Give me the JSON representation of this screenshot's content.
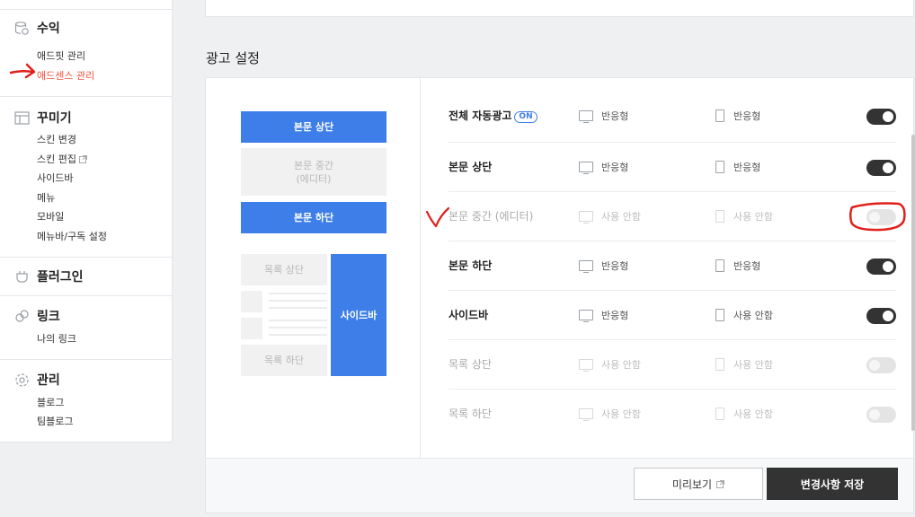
{
  "sidebar": {
    "revenue": {
      "title": "수익",
      "icon": "database-coin-icon",
      "items": [
        "애드핏 관리",
        "애드센스 관리"
      ],
      "active_item": "애드센스 관리"
    },
    "decorate": {
      "title": "꾸미기",
      "icon": "layout-icon",
      "items": [
        "스킨 변경",
        "스킨 편집",
        "사이드바",
        "메뉴",
        "모바일",
        "메뉴바/구독 설정"
      ]
    },
    "plugin": {
      "title": "플러그인",
      "icon": "plug-icon"
    },
    "link": {
      "title": "링크",
      "icon": "link-icon",
      "items": [
        "나의 링크"
      ]
    },
    "manage": {
      "title": "관리",
      "icon": "gear-icon",
      "items": [
        "블로그",
        "팀블로그"
      ]
    }
  },
  "ad_settings": {
    "title": "광고 설정",
    "preview": {
      "top": "본문 상단",
      "middle_line1": "본문 중간",
      "middle_line2": "(에디터)",
      "bottom": "본문 하단",
      "list_top": "목록 상단",
      "list_bottom": "목록 하단",
      "sidebar": "사이드바"
    },
    "rows": [
      {
        "label": "전체 자동광고",
        "badge": "ON",
        "pc": "반응형",
        "mobile": "반응형",
        "enabled": true
      },
      {
        "label": "본문 상단",
        "pc": "반응형",
        "mobile": "반응형",
        "enabled": true
      },
      {
        "label": "본문 중간 (에디터)",
        "pc": "사용 안함",
        "mobile": "사용 안함",
        "enabled": false
      },
      {
        "label": "본문 하단",
        "pc": "반응형",
        "mobile": "반응형",
        "enabled": true
      },
      {
        "label": "사이드바",
        "pc": "반응형",
        "mobile": "사용 안함",
        "enabled": true
      },
      {
        "label": "목록 상단",
        "pc": "사용 안함",
        "mobile": "사용 안함",
        "enabled": false
      },
      {
        "label": "목록 하단",
        "pc": "사용 안함",
        "mobile": "사용 안함",
        "enabled": false
      }
    ],
    "buttons": {
      "preview": "미리보기",
      "save": "변경사항 저장"
    }
  },
  "colors": {
    "accent": "#3d7ee8",
    "active_menu": "#f0513d",
    "toggle_on": "#333333",
    "annotation": "#e0201a"
  }
}
